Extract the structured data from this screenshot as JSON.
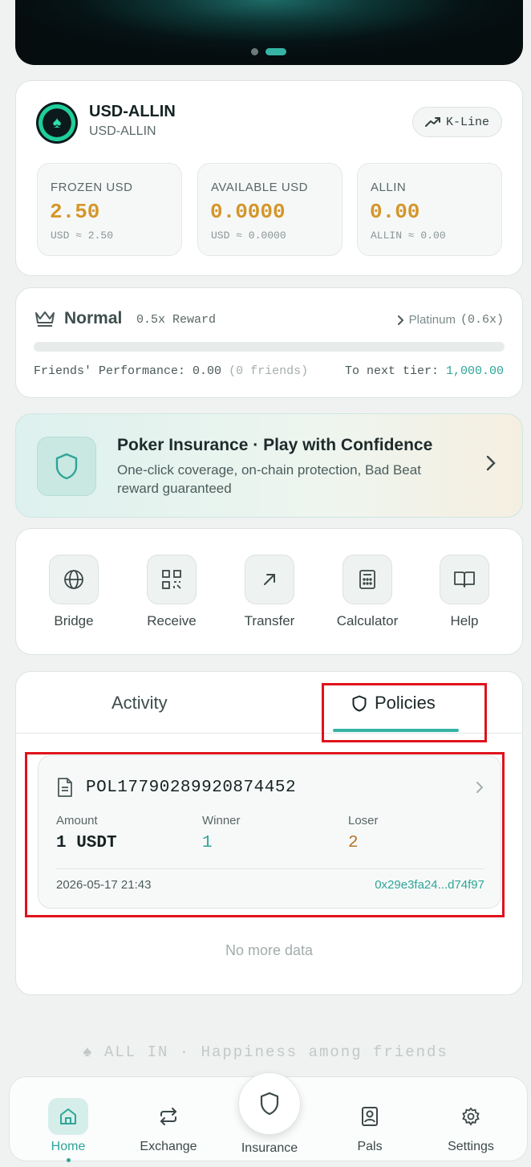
{
  "banner": {
    "active_slide": 2,
    "slides": 2
  },
  "token": {
    "name": "USD-ALLIN",
    "subtitle": "USD-ALLIN",
    "kline_label": "K-Line",
    "stats": [
      {
        "label": "FROZEN USD",
        "value": "2.50",
        "sub": "USD ≈ 2.50"
      },
      {
        "label": "AVAILABLE USD",
        "value": "0.0000",
        "sub": "USD ≈ 0.0000"
      },
      {
        "label": "ALLIN",
        "value": "0.00",
        "sub": "ALLIN ≈ 0.00"
      }
    ]
  },
  "tier": {
    "name": "Normal",
    "reward": "0.5x Reward",
    "next_name": "Platinum",
    "next_mult": "(0.6x)",
    "progress": 0,
    "friends_label": "Friends' Performance:",
    "friends_value": "0.00",
    "friends_count": "(0 friends)",
    "next_tier_label": "To next tier:",
    "next_tier_value": "1,000.00"
  },
  "insurance_promo": {
    "title": "Poker Insurance · Play with Confidence",
    "description": "One-click coverage, on-chain protection, Bad Beat reward guaranteed"
  },
  "actions": [
    {
      "label": "Bridge",
      "icon": "globe-icon"
    },
    {
      "label": "Receive",
      "icon": "qr-code-icon"
    },
    {
      "label": "Transfer",
      "icon": "arrow-up-right-icon"
    },
    {
      "label": "Calculator",
      "icon": "calculator-icon"
    },
    {
      "label": "Help",
      "icon": "book-icon"
    }
  ],
  "tabs": {
    "activity": "Activity",
    "policies": "Policies",
    "active": "Policies"
  },
  "policy": {
    "id": "POL17790289920874452",
    "amount_label": "Amount",
    "amount_value": "1 USDT",
    "winner_label": "Winner",
    "winner_value": "1",
    "loser_label": "Loser",
    "loser_value": "2",
    "date": "2026-05-17 21:43",
    "address": "0x29e3fa24...d74f97"
  },
  "no_more": "No more data",
  "slogan": "♠ ALL IN · Happiness among friends",
  "nav": {
    "home": "Home",
    "exchange": "Exchange",
    "insurance": "Insurance",
    "pals": "Pals",
    "settings": "Settings",
    "active": "Home"
  },
  "colors": {
    "accent": "#36b3a5",
    "gold": "#d4962a",
    "loser": "#b8752a",
    "highlight": "#e0121b"
  }
}
